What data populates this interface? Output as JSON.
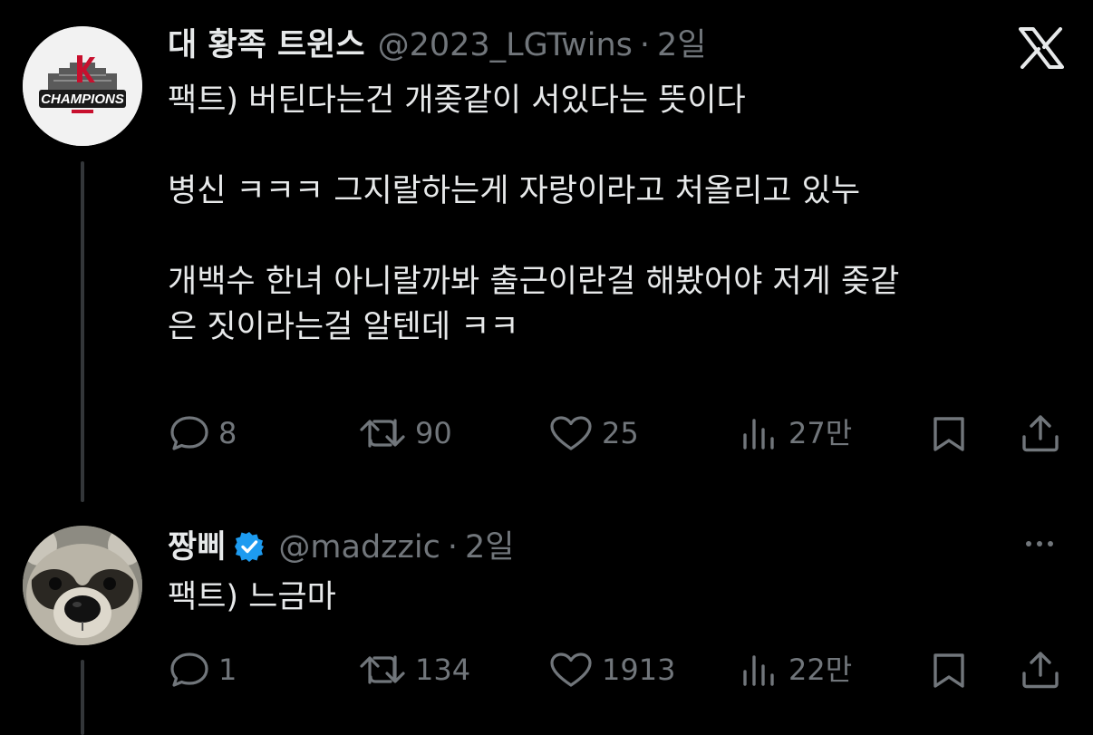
{
  "brand": {
    "logo_icon": "x-logo-icon"
  },
  "tweets": [
    {
      "display_name": "대 황족 트윈스",
      "handle": "@2023_LGTwins",
      "separator": "·",
      "time": "2일",
      "avatar_text": "CHAMPIONS",
      "text": "팩트) 버틴다는건 개좆같이 서있다는 뜻이다\n\n병신 ㅋㅋㅋ 그지랄하는게 자랑이라고 처올리고 있누\n\n개백수 한녀 아니랄까봐 출근이란걸 해봤어야 저게 좆같\n은 짓이라는걸 알텐데 ㅋㅋ",
      "replies": "8",
      "retweets": "90",
      "likes": "25",
      "views": "27만"
    },
    {
      "display_name": "짱삐",
      "verified": true,
      "handle": "@madzzic",
      "separator": "·",
      "time": "2일",
      "text": "팩트) 느금마",
      "replies": "1",
      "retweets": "134",
      "likes": "1913",
      "views": "22만"
    }
  ],
  "colors": {
    "background": "#000000",
    "text_primary": "#e7e9ea",
    "text_secondary": "#71767b",
    "verified_blue": "#1d9bf0",
    "thread_line": "#333639"
  }
}
